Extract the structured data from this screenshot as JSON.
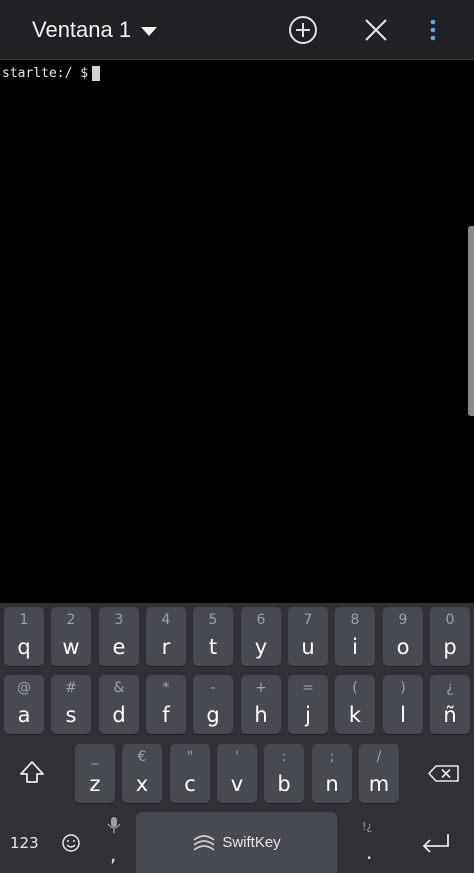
{
  "app_bar": {
    "title": "Ventana 1"
  },
  "terminal": {
    "prompt": "starlte:/ $"
  },
  "keyboard": {
    "row1": [
      {
        "main": "q",
        "hint": "1"
      },
      {
        "main": "w",
        "hint": "2"
      },
      {
        "main": "e",
        "hint": "3"
      },
      {
        "main": "r",
        "hint": "4"
      },
      {
        "main": "t",
        "hint": "5"
      },
      {
        "main": "y",
        "hint": "6"
      },
      {
        "main": "u",
        "hint": "7"
      },
      {
        "main": "i",
        "hint": "8"
      },
      {
        "main": "o",
        "hint": "9"
      },
      {
        "main": "p",
        "hint": "0"
      }
    ],
    "row2": [
      {
        "main": "a",
        "hint": "@"
      },
      {
        "main": "s",
        "hint": "#"
      },
      {
        "main": "d",
        "hint": "&"
      },
      {
        "main": "f",
        "hint": "*"
      },
      {
        "main": "g",
        "hint": "-"
      },
      {
        "main": "h",
        "hint": "+"
      },
      {
        "main": "j",
        "hint": "="
      },
      {
        "main": "k",
        "hint": "("
      },
      {
        "main": "l",
        "hint": ")"
      },
      {
        "main": "ñ",
        "hint": "¿"
      }
    ],
    "row3": [
      {
        "main": "z",
        "hint": "_"
      },
      {
        "main": "x",
        "hint": "€"
      },
      {
        "main": "c",
        "hint": "\""
      },
      {
        "main": "v",
        "hint": "'"
      },
      {
        "main": "b",
        "hint": ":"
      },
      {
        "main": "n",
        "hint": ";"
      },
      {
        "main": "m",
        "hint": "/"
      }
    ],
    "numbers_label": "123",
    "comma": ",",
    "period": ".",
    "period_hint": "!¿",
    "space_label": "SwiftKey"
  }
}
